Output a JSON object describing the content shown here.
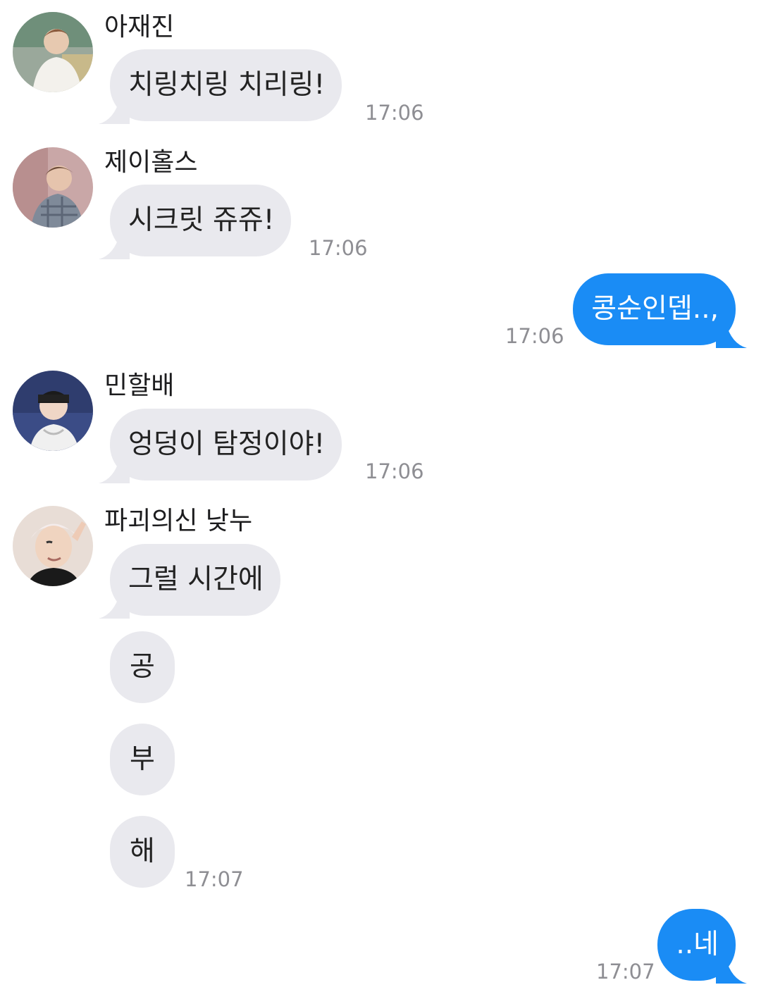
{
  "messages": [
    {
      "sender": "아재진",
      "text": "치링치링 치리링!",
      "time": "17:06"
    },
    {
      "sender": "제이홀스",
      "text": "시크릿 쥬쥬!",
      "time": "17:06"
    },
    {
      "text": "콩순인뎁..,",
      "time": "17:06"
    },
    {
      "sender": "민할배",
      "text": "엉덩이 탐정이야!",
      "time": "17:06"
    },
    {
      "sender": "파괴의신 낮누",
      "texts": [
        "그럴 시간에",
        "공",
        "부",
        "해"
      ],
      "time": "17:07"
    },
    {
      "text": "..네",
      "time": "17:07"
    }
  ],
  "colors": {
    "incoming_bubble": "#e9e9ee",
    "outgoing_bubble": "#1a8cf5",
    "timestamp": "#8e8e93"
  },
  "icons": {
    "avatar_1": "profile-photo",
    "avatar_2": "profile-photo",
    "avatar_4": "profile-photo",
    "avatar_5": "profile-photo"
  }
}
